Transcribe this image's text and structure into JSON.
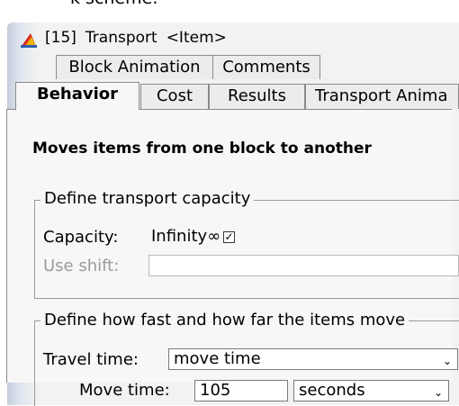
{
  "top_fragment": "k scheme.",
  "window": {
    "icon": "app-icon",
    "block_number": "[15]",
    "block_name": "Transport",
    "block_type": "<Item>"
  },
  "tabs_back": [
    {
      "label": "Block Animation"
    },
    {
      "label": "Comments"
    }
  ],
  "tabs_front": [
    {
      "label": "Behavior",
      "selected": true
    },
    {
      "label": "Cost"
    },
    {
      "label": "Results"
    },
    {
      "label": "Transport Anima"
    }
  ],
  "description": "Moves items from one block to another",
  "capacity_group": {
    "legend": "Define transport capacity",
    "capacity_label": "Capacity:",
    "capacity_value": "Infinity",
    "infinity_symbol": "∞",
    "infinity_checked": true,
    "check_mark": "✓",
    "use_shift_label": "Use shift:",
    "use_shift_value": ""
  },
  "speed_group": {
    "legend": "Define how fast and how far the items move",
    "travel_time_label": "Travel time:",
    "travel_time_value": "move time",
    "move_time_label": "Move time:",
    "move_time_value": "105",
    "units_value": "seconds",
    "dropdown_arrow": "⌄"
  },
  "colors": {
    "tab_border": "#8a8a8a",
    "panel_bg": "#f7f7f7",
    "disabled_text": "#9a9a9a"
  }
}
